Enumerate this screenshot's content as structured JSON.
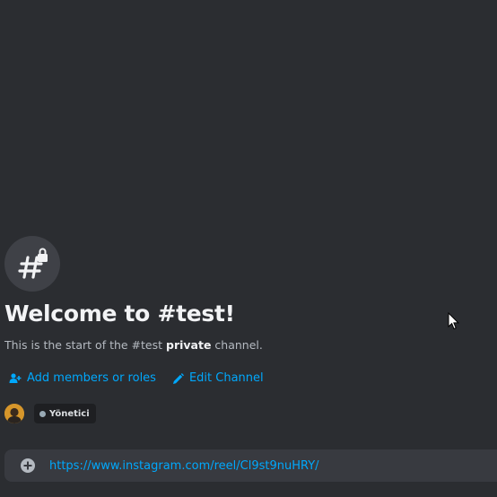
{
  "channel": {
    "icon": "hash-lock-icon",
    "welcome_title": "Welcome to #test!",
    "intro_prefix": "This is the start of the #test ",
    "intro_bold": "private",
    "intro_suffix": " channel."
  },
  "actions": {
    "add_members_label": "Add members or roles",
    "add_members_icon": "add-user-icon",
    "edit_channel_label": "Edit Channel",
    "edit_channel_icon": "pencil-icon"
  },
  "members": {
    "role_label": "Yönetici"
  },
  "composer": {
    "add_icon": "plus-circle-icon",
    "message_value": "https://www.instagram.com/reel/Cl9st9nuHRY/"
  },
  "colors": {
    "background": "#2b2d31",
    "composer_bg": "#383a40",
    "link": "#00a8fc",
    "heading": "#f2f3f5",
    "muted_text": "#b5bac1"
  }
}
